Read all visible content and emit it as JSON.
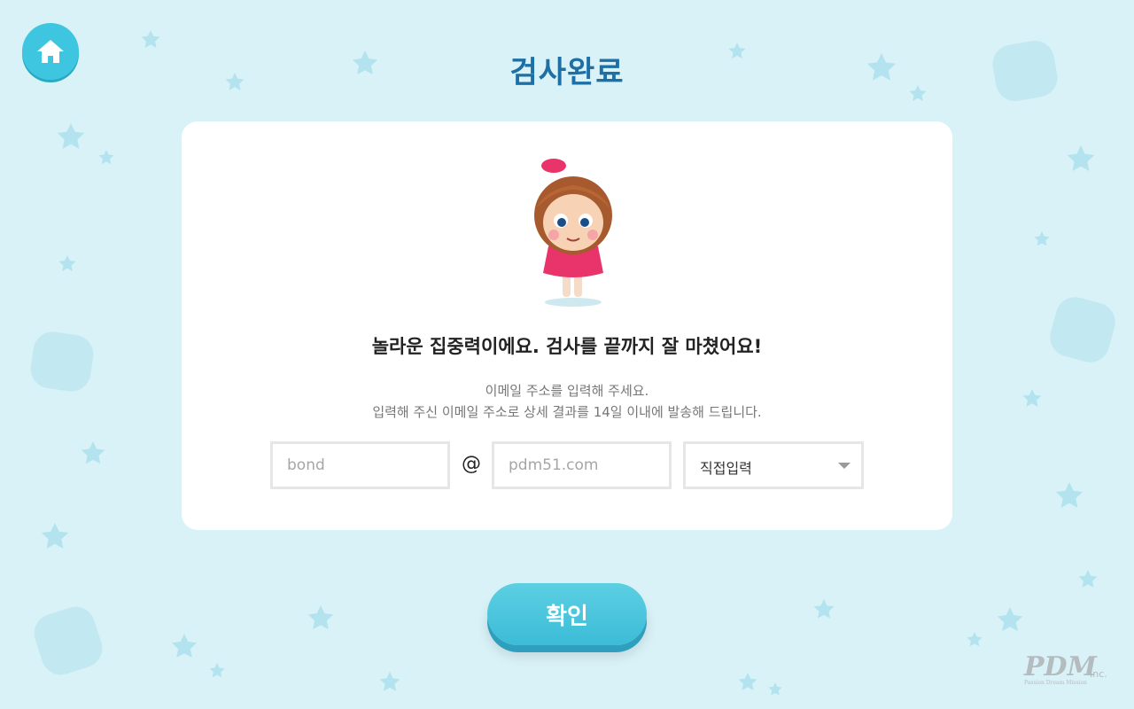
{
  "header": {
    "title": "검사완료",
    "home_icon": "home-icon"
  },
  "card": {
    "headline": "놀라운 집중력이에요. 검사를 끝까지 잘 마쳤어요!",
    "description_line1": "이메일 주소를 입력해 주세요.",
    "description_line2": "입력해 주신 이메일 주소로 상세 결과를 14일 이내에 발송해 드립니다.",
    "email": {
      "local_value": "",
      "local_placeholder": "bond",
      "at_symbol": "@",
      "domain_value": "",
      "domain_placeholder": "pdm51.com",
      "domain_select_value": "직접입력"
    }
  },
  "confirm_button": {
    "label": "확인"
  },
  "branding": {
    "logo_text": "PDM",
    "logo_suffix": "Inc.",
    "logo_tagline": "Passion Dream Mission"
  },
  "colors": {
    "background": "#d9f2f7",
    "accent": "#3ec6e0",
    "title": "#1d6fa6",
    "card": "#ffffff"
  }
}
